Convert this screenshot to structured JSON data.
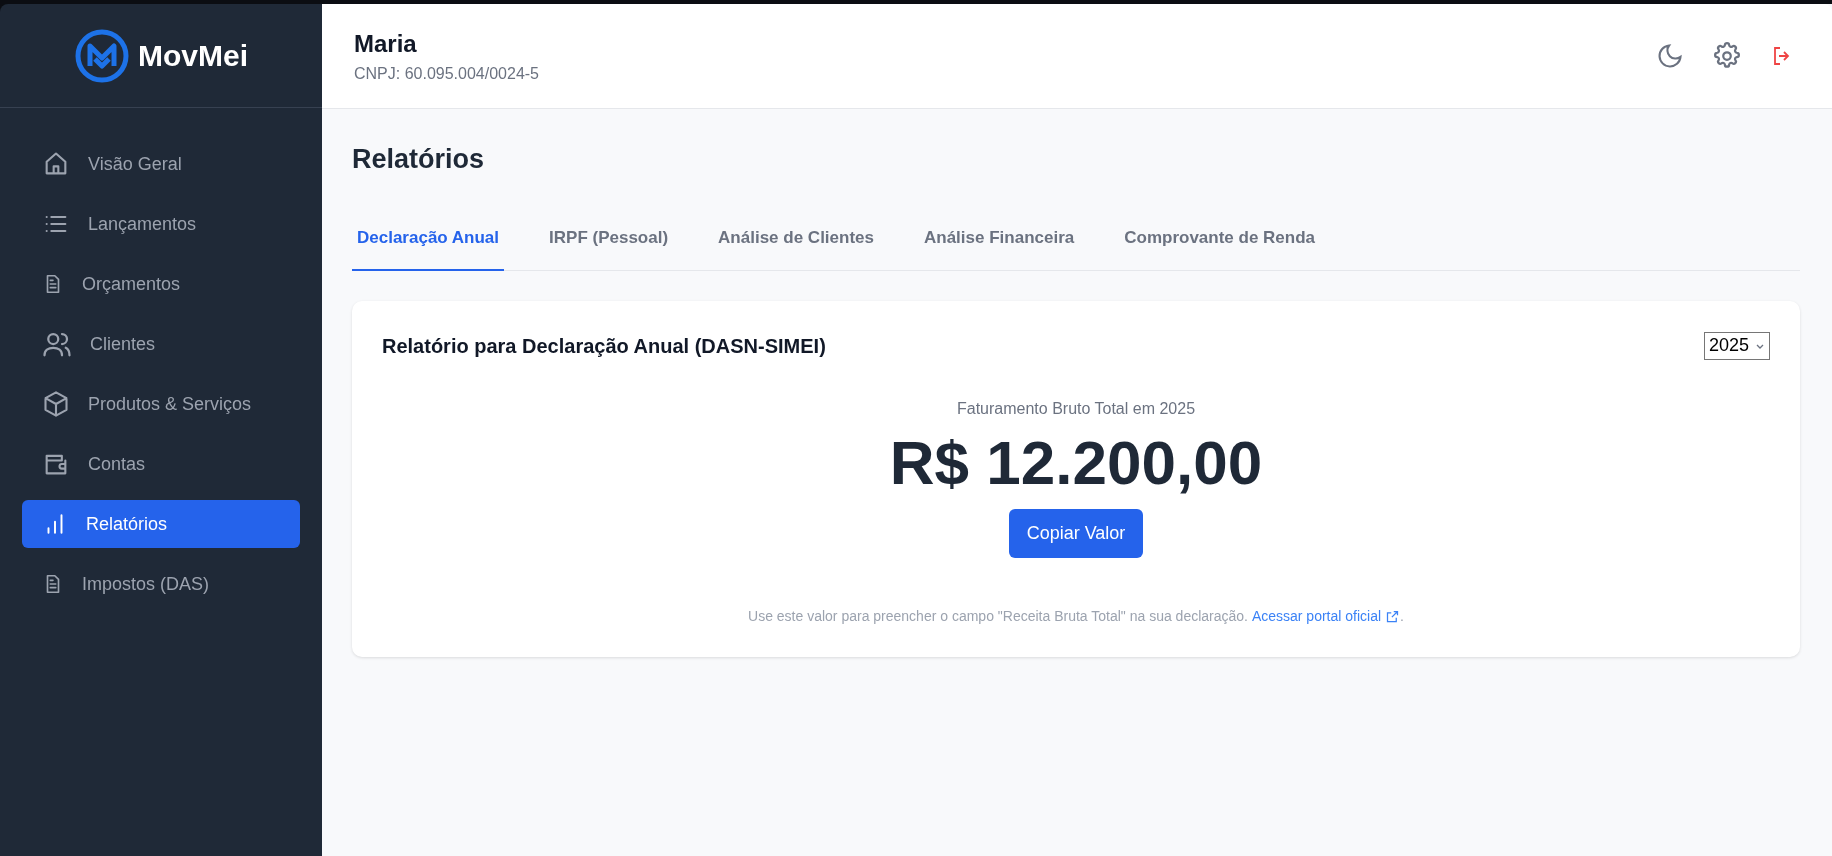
{
  "brand": {
    "name": "MovMei"
  },
  "sidebar": {
    "items": [
      {
        "label": "Visão Geral",
        "selected": false
      },
      {
        "label": "Lançamentos",
        "selected": false
      },
      {
        "label": "Orçamentos",
        "selected": false
      },
      {
        "label": "Clientes",
        "selected": false
      },
      {
        "label": "Produtos & Serviços",
        "selected": false
      },
      {
        "label": "Contas",
        "selected": false
      },
      {
        "label": "Relatórios",
        "selected": true
      },
      {
        "label": "Impostos (DAS)",
        "selected": false
      }
    ]
  },
  "header": {
    "user": "Maria",
    "cnpj": "CNPJ: 60.095.004/0024-5"
  },
  "page_title": "Relatórios",
  "tabs": [
    {
      "label": "Declaração Anual",
      "selected": true
    },
    {
      "label": "IRPF (Pessoal)",
      "selected": false
    },
    {
      "label": "Análise de Clientes",
      "selected": false
    },
    {
      "label": "Análise Financeira",
      "selected": false
    },
    {
      "label": "Comprovante de Renda",
      "selected": false
    }
  ],
  "card": {
    "title": "Relatório para Declaração Anual (DASN-SIMEI)",
    "year": "2025",
    "subtitle": "Faturamento Bruto Total em 2025",
    "amount": "R$ 12.200,00",
    "button": "Copiar Valor",
    "note": {
      "text": "Use este valor para preencher o campo \"Receita Bruta Total\" na sua declaração.",
      "link": "Acessar portal oficial",
      "after": "."
    }
  }
}
